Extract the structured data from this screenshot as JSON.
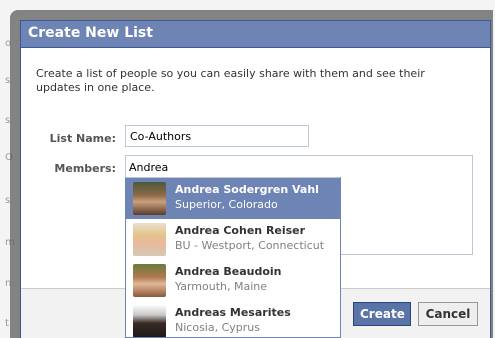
{
  "background": {
    "edge_letters": [
      "o",
      "s",
      "s",
      "O",
      "s",
      "m",
      "n",
      "t"
    ]
  },
  "dialog": {
    "title": "Create New List",
    "intro": "Create a list of people so you can easily share with them and see their updates in one place.",
    "list_name_label": "List Name:",
    "list_name_value": "Co-Authors",
    "members_label": "Members:",
    "members_value": "Andrea",
    "create_button": "Create",
    "cancel_button": "Cancel"
  },
  "suggestions": [
    {
      "name": "Andrea Sodergren Vahl",
      "location": "Superior, Colorado",
      "selected": true
    },
    {
      "name": "Andrea Cohen Reiser",
      "location": "BU - Westport, Connecticut",
      "selected": false
    },
    {
      "name": "Andrea Beaudoin",
      "location": "Yarmouth, Maine",
      "selected": false
    },
    {
      "name": "Andreas Mesarites",
      "location": "Nicosia, Cyprus",
      "selected": false
    }
  ],
  "colors": {
    "header_blue": "#6d84b4",
    "border_blue": "#3b5998",
    "create_button_bg": "#5b74a8"
  }
}
